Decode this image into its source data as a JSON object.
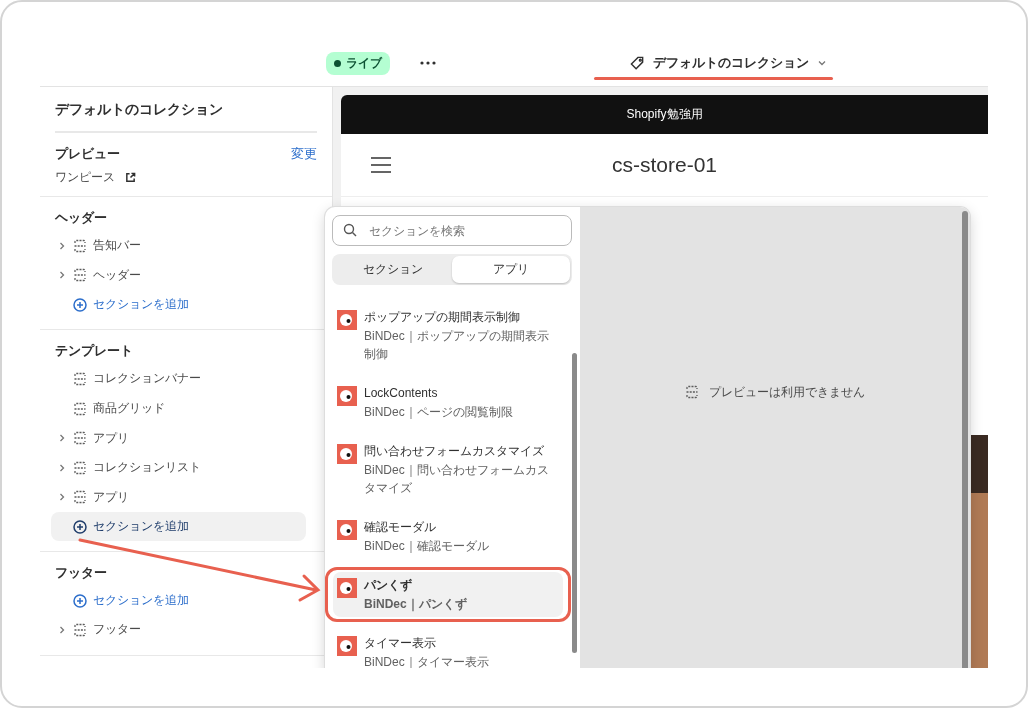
{
  "topbar": {
    "status_badge": "ライブ",
    "template_selector": "デフォルトのコレクション"
  },
  "sidebar": {
    "title": "デフォルトのコレクション",
    "preview": {
      "heading": "プレビュー",
      "change_link": "変更",
      "item": "ワンピース"
    },
    "groups": [
      {
        "heading": "ヘッダー",
        "items": [
          {
            "kind": "section",
            "label": "告知バー",
            "expandable": true
          },
          {
            "kind": "section",
            "label": "ヘッダー",
            "expandable": true
          },
          {
            "kind": "add",
            "label": "セクションを追加",
            "hovered": false
          }
        ]
      },
      {
        "heading": "テンプレート",
        "items": [
          {
            "kind": "section",
            "label": "コレクションバナー",
            "expandable": false
          },
          {
            "kind": "section",
            "label": "商品グリッド",
            "expandable": false
          },
          {
            "kind": "section",
            "label": "アプリ",
            "expandable": true
          },
          {
            "kind": "section",
            "label": "コレクションリスト",
            "expandable": true
          },
          {
            "kind": "section",
            "label": "アプリ",
            "expandable": true
          },
          {
            "kind": "add",
            "label": "セクションを追加",
            "hovered": true
          }
        ]
      },
      {
        "heading": "フッター",
        "items": [
          {
            "kind": "add",
            "label": "セクションを追加",
            "hovered": false
          },
          {
            "kind": "section",
            "label": "フッター",
            "expandable": true
          }
        ]
      }
    ]
  },
  "store": {
    "announcement": "Shopify勉強用",
    "store_name": "cs-store-01"
  },
  "picker": {
    "search_placeholder": "セクションを検索",
    "tabs": [
      {
        "label": "セクション",
        "selected": false
      },
      {
        "label": "アプリ",
        "selected": true
      }
    ],
    "apps": [
      {
        "title": "ポップアップの期間表示制御",
        "subtitle": "BiNDec｜ポップアップの期間表示制御",
        "selected": false
      },
      {
        "title": "LockContents",
        "subtitle": "BiNDec｜ページの閲覧制限",
        "selected": false
      },
      {
        "title": "問い合わせフォームカスタマイズ",
        "subtitle": "BiNDec｜問い合わせフォームカスタマイズ",
        "selected": false
      },
      {
        "title": "確認モーダル",
        "subtitle": "BiNDec｜確認モーダル",
        "selected": false
      },
      {
        "title": "パンくず",
        "subtitle": "BiNDec｜パンくず",
        "selected": true
      },
      {
        "title": "タイマー表示",
        "subtitle": "BiNDec｜タイマー表示",
        "selected": false
      }
    ],
    "preview_message": "プレビューは利用できません"
  }
}
